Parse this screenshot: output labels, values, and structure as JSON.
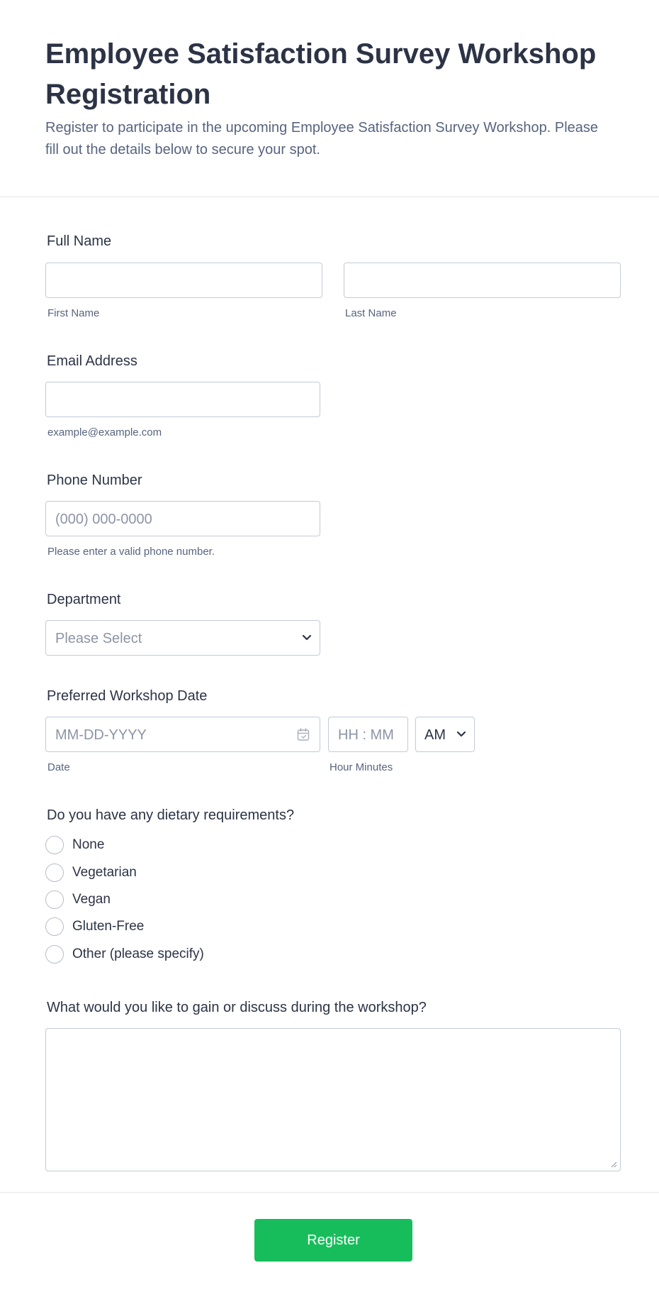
{
  "header": {
    "title": "Employee Satisfaction Survey Workshop Registration",
    "subtitle": "Register to participate in the upcoming Employee Satisfaction Survey Workshop. Please fill out the details below to secure your spot."
  },
  "full_name": {
    "label": "Full Name",
    "first_sublabel": "First Name",
    "last_sublabel": "Last Name",
    "first_value": "",
    "last_value": ""
  },
  "email": {
    "label": "Email Address",
    "value": "",
    "sublabel": "example@example.com"
  },
  "phone": {
    "label": "Phone Number",
    "placeholder": "(000) 000-0000",
    "sublabel": "Please enter a valid phone number."
  },
  "department": {
    "label": "Department",
    "selected": "Please Select"
  },
  "workshop_date": {
    "label": "Preferred Workshop Date",
    "date_placeholder": "MM-DD-YYYY",
    "time_placeholder": "HH : MM",
    "ampm": "AM",
    "date_sublabel": "Date",
    "time_sublabel": "Hour Minutes"
  },
  "dietary": {
    "label": "Do you have any dietary requirements?",
    "options": [
      "None",
      "Vegetarian",
      "Vegan",
      "Gluten-Free",
      "Other (please specify)"
    ]
  },
  "goals": {
    "label": "What would you like to gain or discuss during the workshop?",
    "value": ""
  },
  "submit": {
    "label": "Register"
  },
  "colors": {
    "accent": "#18bd5b",
    "text": "#2c3345",
    "muted": "#57647e",
    "border": "#c3cad8"
  },
  "icons": {
    "department_dropdown": "chevron-down-icon",
    "date_picker": "calendar-icon",
    "ampm_dropdown": "chevron-down-icon"
  }
}
